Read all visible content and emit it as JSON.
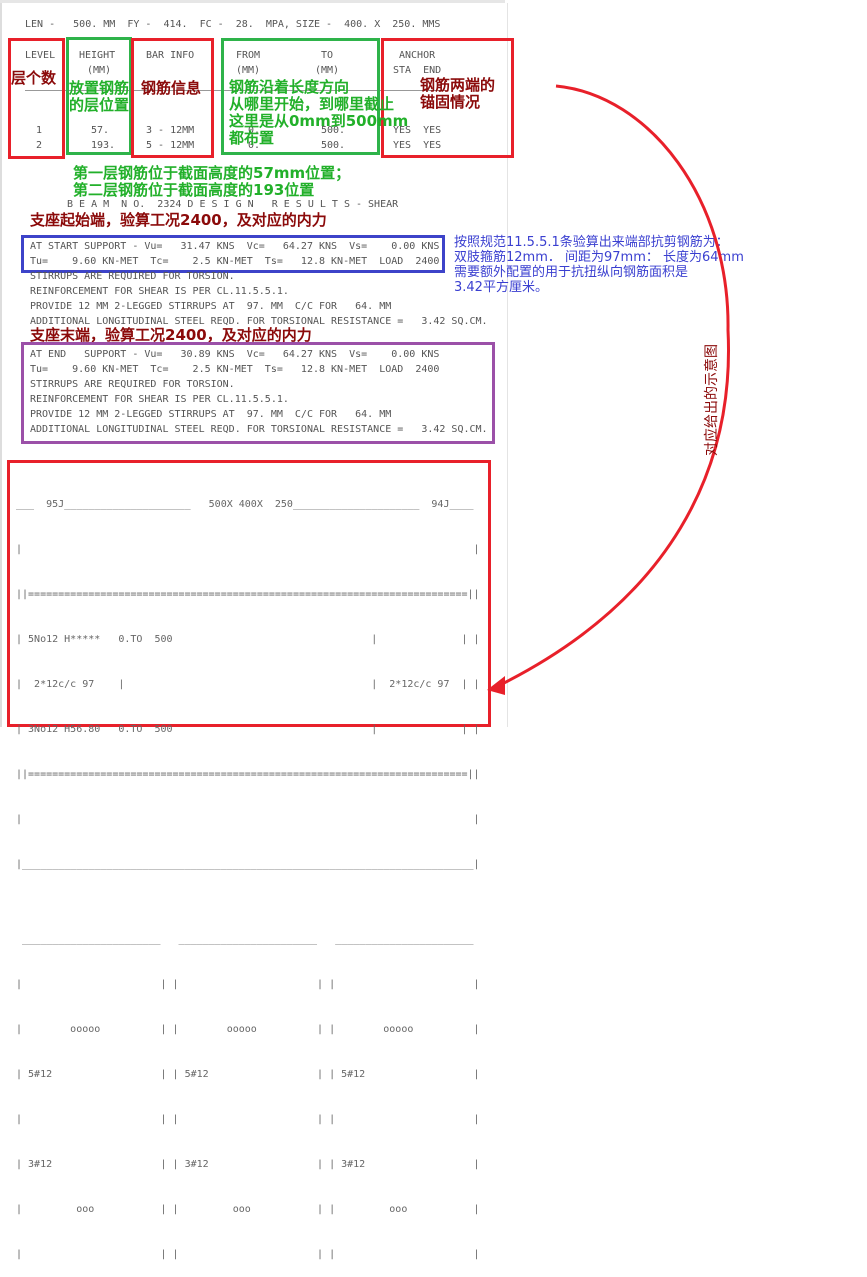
{
  "header_line": "LEN -   500. MM  FY -  414.  FC -  28.  MPA, SIZE -  400. X  250. MMS",
  "table": {
    "level_header": "LEVEL",
    "height_header": [
      "HEIGHT",
      "(MM)"
    ],
    "barinfo_header": "BAR INFO",
    "from_header": [
      "FROM",
      "(MM)"
    ],
    "to_header": [
      "TO",
      "(MM)"
    ],
    "anchor_header": [
      "ANCHOR",
      "STA  END"
    ],
    "rows": [
      {
        "level": "1",
        "height": "57.",
        "bar": "3 - 12MM",
        "from": "0.",
        "to": "500.",
        "anchor": "YES  YES"
      },
      {
        "level": "2",
        "height": "193.",
        "bar": "5 - 12MM",
        "from": "0.",
        "to": "500.",
        "anchor": "YES  YES"
      }
    ]
  },
  "annotations": {
    "level_count": "层个数",
    "height_pos": "放置钢筋\n的层位置",
    "bar_info": "钢筋信息",
    "from_to": "钢筋沿着长度方向\n从哪里开始，到哪里截止\n这里是从0mm到500mm\n都布置",
    "anchor": "钢筋两端的\n锚固情况",
    "layer_note": "第一层钢筋位于截面高度的57mm位置；\n第二层钢筋位于截面高度的193位置",
    "start_support": "支座起始端，验算工况2400，及对应的内力",
    "end_support": "支座末端，验算工况2400，及对应的内力",
    "code_note": "按照规范11.5.5.1条验算出来端部抗剪钢筋为：\n双肢箍筋12mm． 间距为97mm： 长度为64mm\n需要额外配置的用于抗扭纵向钢筋面积是\n3.42平方厘米。",
    "diagram_note": "对应给出的示意图"
  },
  "shear_title": "B E A M  N O.  2324 D E S I G N   R E S U L T S - SHEAR",
  "start_block": [
    "AT START SUPPORT - Vu=   31.47 KNS  Vc=   64.27 KNS  Vs=    0.00 KNS",
    "Tu=    9.60 KN-MET  Tc=    2.5 KN-MET  Ts=   12.8 KN-MET  LOAD  2400",
    "STIRRUPS ARE REQUIRED FOR TORSION.",
    "REINFORCEMENT FOR SHEAR IS PER CL.11.5.5.1.",
    "PROVIDE 12 MM 2-LEGGED STIRRUPS AT  97. MM  C/C FOR   64. MM",
    "ADDITIONAL LONGITUDINAL STEEL REQD. FOR TORSIONAL RESISTANCE =   3.42 SQ.CM."
  ],
  "end_block": [
    "AT END   SUPPORT - Vu=   30.89 KNS  Vc=   64.27 KNS  Vs=    0.00 KNS",
    "Tu=    9.60 KN-MET  Tc=    2.5 KN-MET  Ts=   12.8 KN-MET  LOAD  2400",
    "STIRRUPS ARE REQUIRED FOR TORSION.",
    "REINFORCEMENT FOR SHEAR IS PER CL.11.5.5.1.",
    "PROVIDE 12 MM 2-LEGGED STIRRUPS AT  97. MM  C/C FOR   64. MM",
    "ADDITIONAL LONGITUDINAL STEEL REQD. FOR TORSIONAL RESISTANCE =   3.42 SQ.CM."
  ],
  "diagram": [
    "___  95J_____________________   500X 400X  250_____________________  94J____",
    "|                                                                           |",
    "||=========================================================================||",
    "| 5No12 H*****   0.TO  500                                 |              | |",
    "|  2*12c/c 97    |                                         |  2*12c/c 97  | |",
    "| 3No12 H56.80   0.TO  500                                 |              | |",
    "||=========================================================================||",
    "|                                                                           |",
    "|___________________________________________________________________________|",
    "",
    " _______________________   _______________________   _______________________",
    "|                       | |                       | |                       |",
    "|        ooooo          | |        ooooo          | |        ooooo          |",
    "| 5#12                  | | 5#12                  | | 5#12                  |",
    "|                       | |                       | |                       |",
    "| 3#12                  | | 3#12                  | | 3#12                  |",
    "|         ooo           | |         ooo           | |         ooo           |",
    "|                       | |                       | |                       |"
  ],
  "colors": {
    "red": "#e8202a",
    "green": "#2eb34a",
    "blue": "#3d43c9",
    "purple": "#9b50a8"
  }
}
